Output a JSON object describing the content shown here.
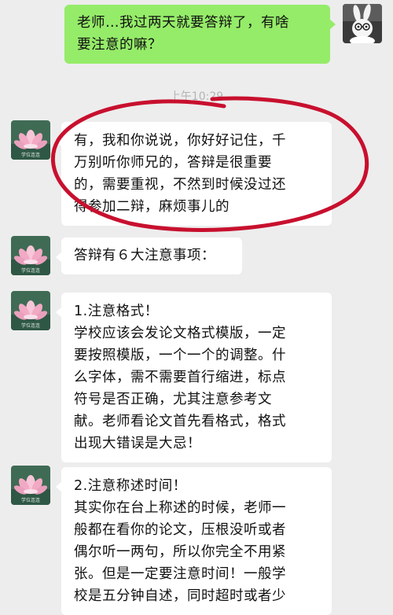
{
  "chat": {
    "timestamp": "上午10:29",
    "messages": [
      {
        "sender": "student",
        "lines": [
          "老师…我过两天就要答辩了，有啥",
          "要注意的嘛？"
        ]
      },
      {
        "sender": "teacher",
        "lines": [
          "有，我和你说说，你好好记住，千",
          "万别听你师兄的，答辩是很重要",
          "的，需要重视，不然到时候没过还",
          "得参加二辩，麻烦事儿的"
        ]
      },
      {
        "sender": "teacher",
        "lines": [
          "答辩有６大注意事项："
        ]
      },
      {
        "sender": "teacher",
        "lines": [
          "1.注意格式！",
          "学校应该会发论文格式模版，一定",
          "要按照模版，一个一个的调整。什",
          "么字体，需不需要首行缩进，标点",
          "符号是否正确，尤其注意参考文",
          "献。老师看论文首先看格式，格式",
          "出现大错误是大忌！"
        ]
      },
      {
        "sender": "teacher",
        "lines": [
          "2.注意称述时间！",
          "其实你在台上称述的时候，老师一",
          "般都在看你的论文，压根没听或者",
          "偶尔听一两句，所以你完全不用紧",
          "张。但是一定要注意时间！一般学",
          "校是五分钟自述，同时超时或者少"
        ]
      }
    ],
    "avatar_caption": "学位连连",
    "colors": {
      "background": "#ededed",
      "bubble_self": "#95ec69",
      "bubble_other": "#ffffff",
      "annotation": "#c8102e"
    }
  }
}
